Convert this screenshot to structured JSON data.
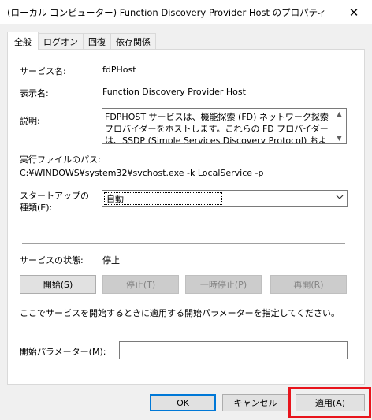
{
  "window": {
    "title": "(ローカル コンピューター) Function Discovery Provider Host のプロパティ",
    "close_glyph": "✕"
  },
  "tabs": [
    {
      "label": "全般",
      "active": true
    },
    {
      "label": "ログオン",
      "active": false
    },
    {
      "label": "回復",
      "active": false
    },
    {
      "label": "依存関係",
      "active": false
    }
  ],
  "general": {
    "service_name_label": "サービス名:",
    "service_name_value": "fdPHost",
    "display_name_label": "表示名:",
    "display_name_value": "Function Discovery Provider Host",
    "description_label": "説明:",
    "description_value": "FDPHOST サービスは、機能探索 (FD) ネットワーク探索プロバイダーをホストします。これらの FD プロバイダーは、SSDP (Simple Services Discovery Protocol) および WS-D (Web",
    "executable_path_label": "実行ファイルのパス:",
    "executable_path_value": "C:¥WINDOWS¥system32¥svchost.exe -k LocalService -p",
    "startup_type_label_line1": "スタートアップの",
    "startup_type_label_line2": "種類(E):",
    "startup_type_value": "自動",
    "service_status_label": "サービスの状態:",
    "service_status_value": "停止",
    "buttons": {
      "start": "開始(S)",
      "stop": "停止(T)",
      "pause": "一時停止(P)",
      "resume": "再開(R)"
    },
    "start_params_hint": "ここでサービスを開始するときに適用する開始パラメーターを指定してください。",
    "start_params_label": "開始パラメーター(M):",
    "start_params_value": ""
  },
  "footer": {
    "ok": "OK",
    "cancel": "キャンセル",
    "apply": "適用(A)"
  },
  "colors": {
    "highlight": "#e8141c",
    "default_button_border": "#0078d7"
  }
}
